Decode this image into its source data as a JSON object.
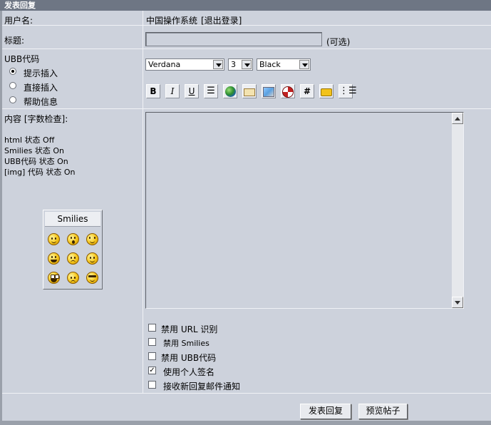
{
  "window": {
    "title": "发表回复"
  },
  "rows": {
    "username_label": "用户名:",
    "username_value": "中国操作系统",
    "logout_link": "[退出登录]",
    "subject_label": "标题:",
    "subject_value": "",
    "subject_hint": "(可选)",
    "ubb_label": "UBB代码",
    "radio_options": [
      "提示插入",
      "直接插入",
      "帮助信息"
    ],
    "radio_selected": "提示插入",
    "content_label": "内容",
    "char_check_link": "[字数检查]",
    "content_colon": ":"
  },
  "status": {
    "html": "html 状态  Off",
    "smilies": "Smilies 状态  On",
    "ubb": "UBB代码  状态  On",
    "img": "[img] 代码  状态  On"
  },
  "font_selects": {
    "font": "Verdana",
    "size": "3",
    "color": "Black"
  },
  "toolbar_icons": [
    "bold-icon",
    "italic-icon",
    "underline-icon",
    "center-align-icon",
    "globe-link-icon",
    "email-icon",
    "image-icon",
    "flash-icon",
    "hash-code-icon",
    "quote-icon",
    "list-icon"
  ],
  "smilies_panel": {
    "title": "Smilies"
  },
  "options": [
    {
      "label": "禁用  URL 识别",
      "checked": false
    },
    {
      "label": "禁用  Smilies",
      "checked": false
    },
    {
      "label": "禁用  UBB代码",
      "checked": false
    },
    {
      "label": "使用个人签名",
      "checked": true
    },
    {
      "label": "接收新回复邮件通知",
      "checked": false
    }
  ],
  "buttons": {
    "submit": "发表回复",
    "preview": "预览帖子"
  },
  "content_text": ""
}
